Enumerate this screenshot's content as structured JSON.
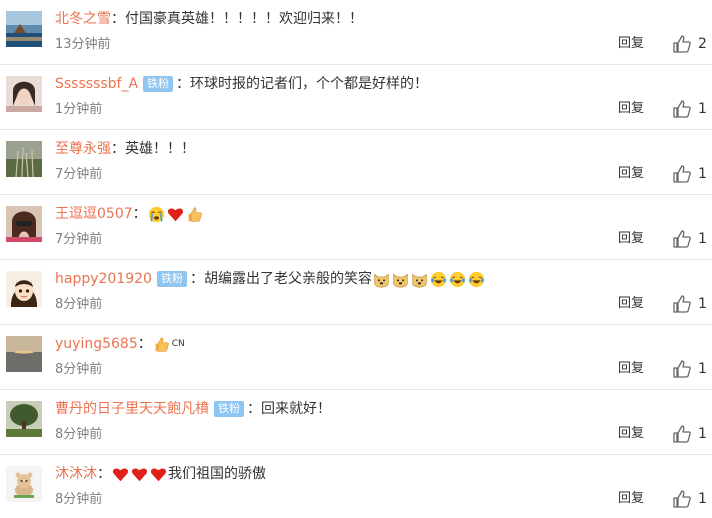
{
  "reply_label": "回复",
  "colors": {
    "name": "#eb7350",
    "badge": "#8fc5f1",
    "time": "#808080",
    "separator": "#e6e6e6"
  },
  "comments": [
    {
      "name": "北冬之雪",
      "badge": "",
      "separator": "：",
      "text": "付国豪真英雄！！！！！欢迎归来！！",
      "emojis": [],
      "time": "13分钟前",
      "likes": "2",
      "avatar": "avatar-coast-sunset"
    },
    {
      "name": "Sssssssbf_A",
      "badge": "铁粉",
      "separator": "：",
      "text": "环球时报的记者们，个个都是好样的！",
      "emojis": [],
      "time": "1分钟前",
      "likes": "1",
      "avatar": "avatar-portrait-woman"
    },
    {
      "name": "至尊永强",
      "badge": "",
      "separator": "：",
      "text": "英雄！！！",
      "emojis": [],
      "time": "7分钟前",
      "likes": "1",
      "avatar": "avatar-grass-field"
    },
    {
      "name": "王逗逗0507",
      "badge": "",
      "separator": "：",
      "text": "",
      "emojis": [
        "crying-face-icon",
        "heart-icon",
        "thumbs-up-icon"
      ],
      "time": "7分钟前",
      "likes": "1",
      "avatar": "avatar-portrait-sunglasses"
    },
    {
      "name": "happy201920",
      "badge": "铁粉",
      "separator": "：",
      "text": "胡编露出了老父亲般的笑容",
      "emojis": [
        "doge-icon",
        "doge-icon",
        "doge-icon",
        "laughing-tears-icon",
        "laughing-tears-icon",
        "laughing-tears-icon"
      ],
      "time": "8分钟前",
      "likes": "1",
      "avatar": "avatar-cartoon-girl"
    },
    {
      "name": "yuying5685",
      "badge": "",
      "separator": "：",
      "text": "",
      "emojis": [
        "thumbs-up-icon"
      ],
      "suffix": "CN",
      "time": "8分钟前",
      "likes": "1",
      "avatar": "avatar-lake-dusk"
    },
    {
      "name": "曹丹的日子里天天飽凡橨",
      "badge": "铁粉",
      "separator": "：",
      "text": "回来就好！",
      "emojis": [],
      "time": "8分钟前",
      "likes": "1",
      "avatar": "avatar-garden-tree"
    },
    {
      "name": "沐沐沐",
      "badge": "",
      "separator": "：",
      "text": "我们祖国的骄傲",
      "emojis": [
        "heart-icon",
        "heart-icon",
        "heart-icon"
      ],
      "emojis_before_text": true,
      "time": "8分钟前",
      "likes": "1",
      "avatar": "avatar-cartoon-bear"
    }
  ]
}
